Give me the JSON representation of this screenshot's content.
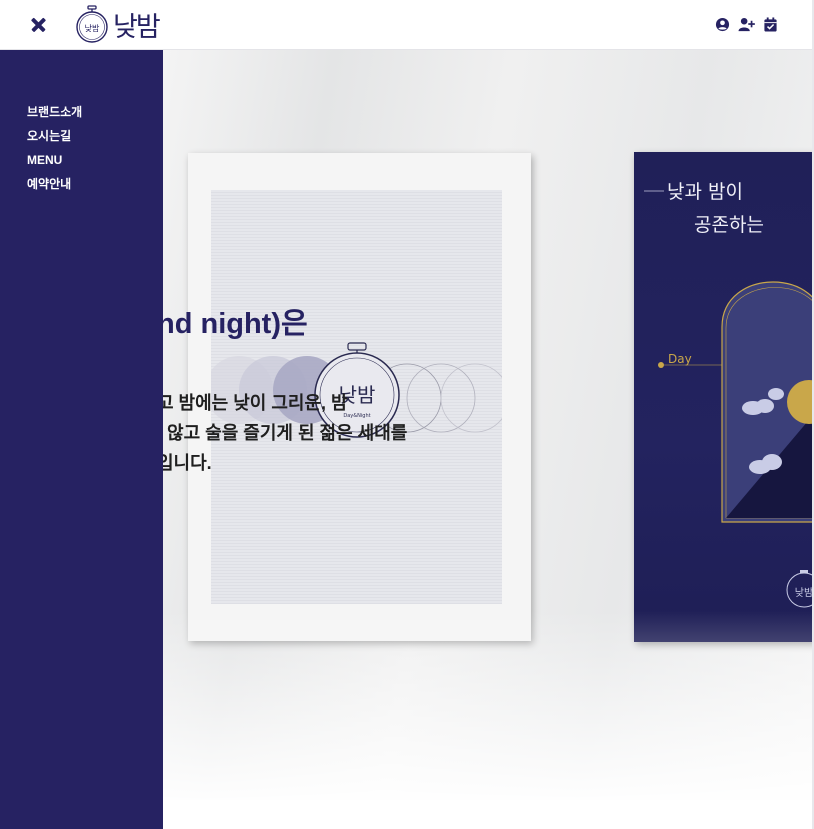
{
  "header": {
    "logo_text": "낮밤",
    "logo_mark_text": "낮밤",
    "icons": [
      "user-circle-icon",
      "user-plus-icon",
      "calendar-check-icon"
    ],
    "colors": {
      "brand": "#262262",
      "background": "#ffffff"
    }
  },
  "side_nav": {
    "background": "#262262",
    "items": [
      {
        "label": "브랜드소개"
      },
      {
        "label": "오시는길"
      },
      {
        "label": "MENU"
      },
      {
        "label": "예약안내"
      }
    ]
  },
  "hero": {
    "headline": "nd night)은",
    "body_lines": [
      "고 밤에는 낮이 그리운, 밤",
      "| 않고 술을 즐기게 된 젊은 세대를",
      "입니다."
    ],
    "poster_white": {
      "logo_text": "낮밤",
      "logo_subtext": "Day&Night"
    },
    "poster_navy": {
      "title_line_1": "낮과 밤이",
      "title_line_2": "공존하는",
      "day_label": "Day",
      "logo_text": "낮밤"
    }
  }
}
